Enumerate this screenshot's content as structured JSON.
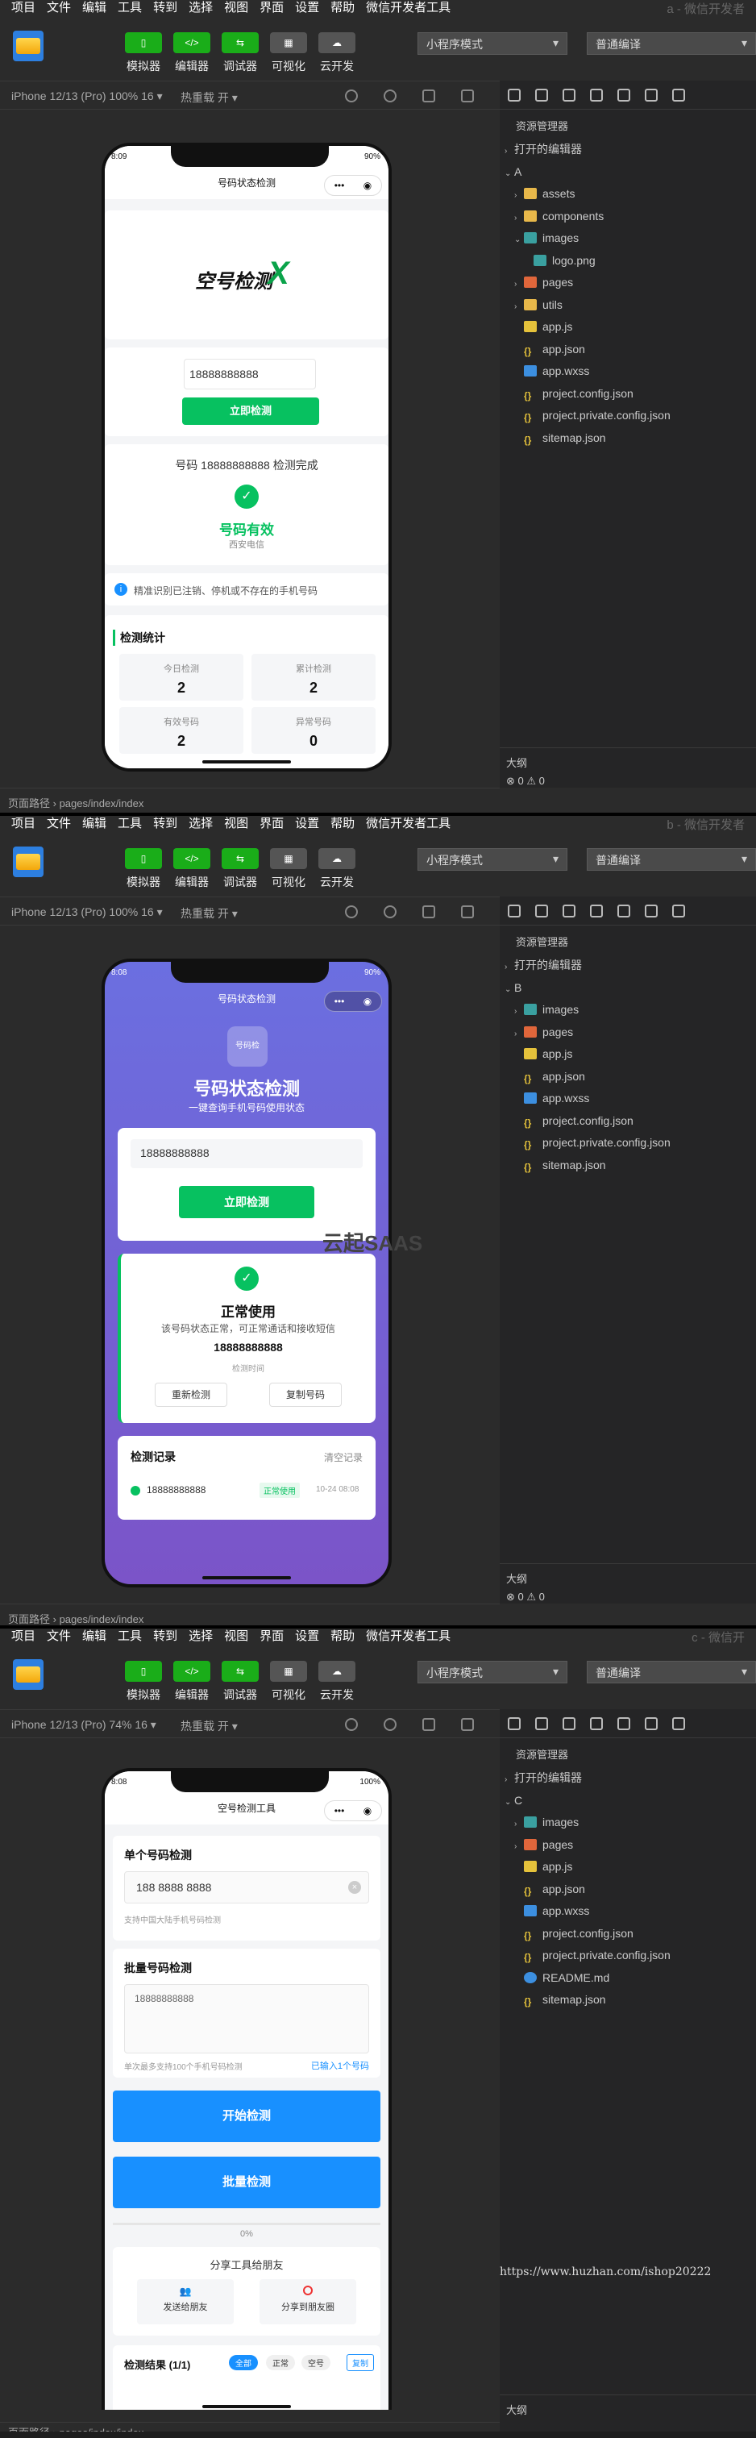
{
  "menu": [
    "项目",
    "文件",
    "编辑",
    "工具",
    "转到",
    "选择",
    "视图",
    "界面",
    "设置",
    "帮助",
    "微信开发者工具"
  ],
  "toolbar": {
    "buttons": [
      "模拟器",
      "编辑器",
      "调试器",
      "可视化",
      "云开发"
    ],
    "mode_select": "小程序模式",
    "compile_select": "普通编译"
  },
  "common": {
    "hot_reload": "热重载 开 ▾",
    "footer_path_label": "页面路径",
    "footer_path": "pages/index/index",
    "explorer_title": "资源管理器",
    "open_editors": "打开的编辑器",
    "outline": "大纲",
    "problems": "⊗ 0 ⚠ 0"
  },
  "a": {
    "window_tag": "a - 微信开发者",
    "device": "iPhone 12/13 (Pro) 100% 16 ▾",
    "root": "A",
    "files": [
      {
        "name": "assets",
        "type": "folder",
        "arrow": "›",
        "indent": 1
      },
      {
        "name": "components",
        "type": "folder",
        "arrow": "›",
        "indent": 1
      },
      {
        "name": "images",
        "type": "folder-open",
        "arrow": "⌄",
        "indent": 1
      },
      {
        "name": "logo.png",
        "type": "image",
        "arrow": "",
        "indent": 2
      },
      {
        "name": "pages",
        "type": "folder-red",
        "arrow": "›",
        "indent": 1
      },
      {
        "name": "utils",
        "type": "folder",
        "arrow": "›",
        "indent": 1
      },
      {
        "name": "app.js",
        "type": "js",
        "arrow": "",
        "indent": 1
      },
      {
        "name": "app.json",
        "type": "json",
        "arrow": "",
        "indent": 1
      },
      {
        "name": "app.wxss",
        "type": "css",
        "arrow": "",
        "indent": 1
      },
      {
        "name": "project.config.json",
        "type": "json",
        "arrow": "",
        "indent": 1
      },
      {
        "name": "project.private.config.json",
        "type": "json",
        "arrow": "",
        "indent": 1
      },
      {
        "name": "sitemap.json",
        "type": "json",
        "arrow": "",
        "indent": 1
      }
    ],
    "phone": {
      "time": "8:09",
      "battery": "90%",
      "nav_title": "号码状态检测",
      "logo_text": "空号检测",
      "logo_mark": "X",
      "input": "18888888888",
      "button": "立即检测",
      "result_line": "号码 18888888888 检测完成",
      "result_status": "号码有效",
      "result_carrier": "西安电信",
      "tip": "精准识别已注销、停机或不存在的手机号码",
      "stats_title": "检测统计",
      "stats": [
        {
          "label": "今日检测",
          "value": "2"
        },
        {
          "label": "累计检测",
          "value": "2"
        },
        {
          "label": "有效号码",
          "value": "2"
        },
        {
          "label": "异常号码",
          "value": "0"
        }
      ]
    }
  },
  "b": {
    "window_tag": "b - 微信开发者",
    "device": "iPhone 12/13 (Pro) 100% 16 ▾",
    "root": "B",
    "watermark": "云起SAAS",
    "files": [
      {
        "name": "images",
        "type": "folder-open",
        "arrow": "›",
        "indent": 1
      },
      {
        "name": "pages",
        "type": "folder-red",
        "arrow": "›",
        "indent": 1
      },
      {
        "name": "app.js",
        "type": "js",
        "arrow": "",
        "indent": 1
      },
      {
        "name": "app.json",
        "type": "json",
        "arrow": "",
        "indent": 1
      },
      {
        "name": "app.wxss",
        "type": "css",
        "arrow": "",
        "indent": 1
      },
      {
        "name": "project.config.json",
        "type": "json",
        "arrow": "",
        "indent": 1
      },
      {
        "name": "project.private.config.json",
        "type": "json",
        "arrow": "",
        "indent": 1
      },
      {
        "name": "sitemap.json",
        "type": "json",
        "arrow": "",
        "indent": 1
      }
    ],
    "phone": {
      "time": "8:08",
      "battery": "90%",
      "nav_title": "号码状态检测",
      "badge": "号码检",
      "hero_title": "号码状态检测",
      "hero_sub": "一键查询手机号码使用状态",
      "input": "18888888888",
      "button": "立即检测",
      "result_title": "正常使用",
      "result_desc": "该号码状态正常，可正常通话和接收短信",
      "result_number": "18888888888",
      "result_time": "检测时间",
      "recheck": "重新检测",
      "copy": "复制号码",
      "history_title": "检测记录",
      "clear": "清空记录",
      "history_number": "18888888888",
      "history_tag": "正常使用",
      "history_time": "10-24 08:08"
    }
  },
  "c": {
    "window_tag": "c - 微信开",
    "device": "iPhone 12/13 (Pro) 74% 16 ▾",
    "root": "C",
    "url_watermark": "https://www.huzhan.com/ishop20222",
    "files": [
      {
        "name": "images",
        "type": "folder-open",
        "arrow": "›",
        "indent": 1
      },
      {
        "name": "pages",
        "type": "folder-red",
        "arrow": "›",
        "indent": 1
      },
      {
        "name": "app.js",
        "type": "js",
        "arrow": "",
        "indent": 1
      },
      {
        "name": "app.json",
        "type": "json",
        "arrow": "",
        "indent": 1
      },
      {
        "name": "app.wxss",
        "type": "css",
        "arrow": "",
        "indent": 1
      },
      {
        "name": "project.config.json",
        "type": "json",
        "arrow": "",
        "indent": 1
      },
      {
        "name": "project.private.config.json",
        "type": "json",
        "arrow": "",
        "indent": 1
      },
      {
        "name": "README.md",
        "type": "info",
        "arrow": "",
        "indent": 1
      },
      {
        "name": "sitemap.json",
        "type": "json",
        "arrow": "",
        "indent": 1
      }
    ],
    "phone": {
      "time": "8:08",
      "battery": "100%",
      "nav_title": "空号检测工具",
      "single_title": "单个号码检测",
      "single_input": "188 8888 8888",
      "single_hint": "支持中国大陆手机号码检测",
      "batch_title": "批量号码检测",
      "batch_value": "18888888888",
      "batch_hint": "单次最多支持100个手机号码检测",
      "batch_count": "已输入1个号码",
      "start_button": "开始检测",
      "batch_button": "批量检测",
      "progress": "0%",
      "share_title": "分享工具给朋友",
      "share_friend": "发送给朋友",
      "share_moments": "分享到朋友圈",
      "results_title": "检测结果 (1/1)",
      "filters": [
        "全部",
        "正常",
        "空号"
      ],
      "copy": "复制"
    }
  },
  "colors": {
    "green": "#07c160",
    "blue": "#1890ff",
    "purple_top": "#6b6fe0",
    "purple_bottom": "#7b54c8",
    "ide_bg": "#2b2b2b"
  }
}
